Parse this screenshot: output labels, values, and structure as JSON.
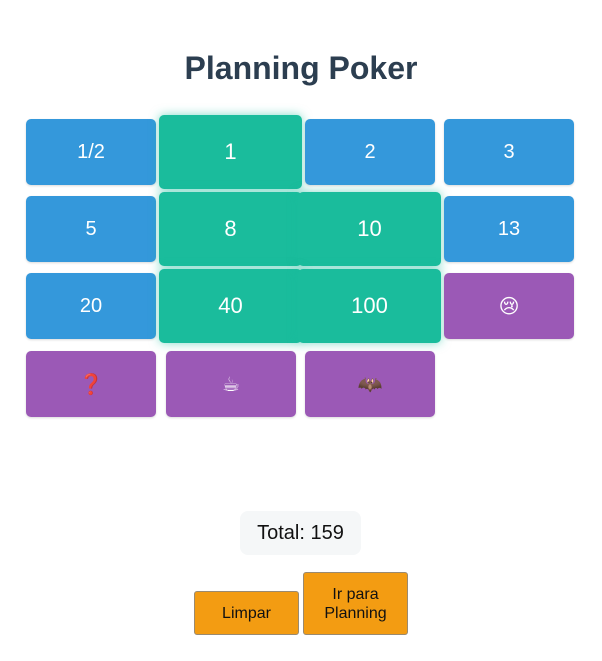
{
  "title": "Planning Poker",
  "cards": [
    {
      "label": "1/2",
      "name": "card-half",
      "color": "blue",
      "selected": false
    },
    {
      "label": "1",
      "name": "card-1",
      "color": "green",
      "selected": true
    },
    {
      "label": "2",
      "name": "card-2",
      "color": "blue",
      "selected": false
    },
    {
      "label": "3",
      "name": "card-3",
      "color": "blue",
      "selected": false
    },
    {
      "label": "5",
      "name": "card-5",
      "color": "blue",
      "selected": false
    },
    {
      "label": "8",
      "name": "card-8",
      "color": "green",
      "selected": true
    },
    {
      "label": "10",
      "name": "card-10",
      "color": "green",
      "selected": true
    },
    {
      "label": "13",
      "name": "card-13",
      "color": "blue",
      "selected": false
    },
    {
      "label": "20",
      "name": "card-20",
      "color": "blue",
      "selected": false
    },
    {
      "label": "40",
      "name": "card-40",
      "color": "green",
      "selected": true
    },
    {
      "label": "100",
      "name": "card-100",
      "color": "green",
      "selected": true
    },
    {
      "label": "😢",
      "name": "card-crying-face",
      "color": "purple",
      "selected": false,
      "icon": "crying-face-icon"
    },
    {
      "label": "❓",
      "name": "card-question",
      "color": "purple",
      "selected": false,
      "icon": "question-mark-icon"
    },
    {
      "label": "☕",
      "name": "card-coffee",
      "color": "purple",
      "selected": false,
      "icon": "coffee-icon"
    },
    {
      "label": "🦇",
      "name": "card-bat",
      "color": "purple",
      "selected": false,
      "icon": "bat-icon"
    }
  ],
  "total": {
    "text": "Total: 159"
  },
  "buttons": {
    "clear": "Limpar",
    "planning": "Ir para Planning"
  },
  "colors": {
    "blue": "#3498db",
    "green": "#1abc9c",
    "purple": "#9b59b6",
    "button": "#f39c12",
    "title": "#2c3e50"
  }
}
